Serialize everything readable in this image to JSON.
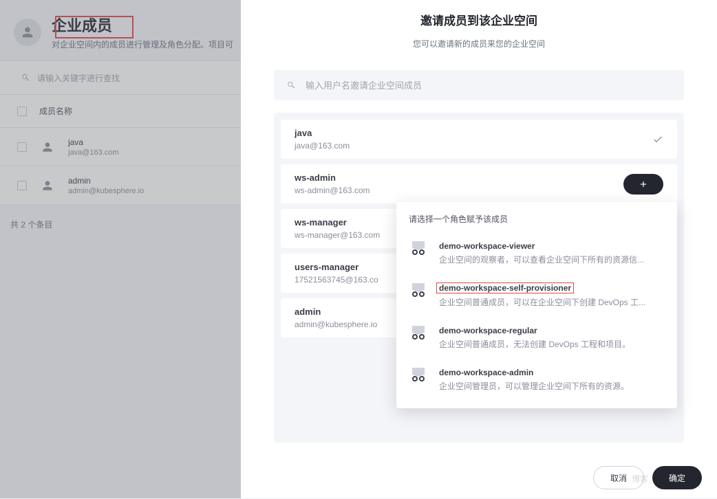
{
  "bg": {
    "title": "企业成员",
    "subtitle": "对企业空间内的成员进行管理及角色分配。项目可",
    "search_placeholder": "请输入关键字进行查找",
    "col_name": "成员名称",
    "rows": [
      {
        "name": "java",
        "email": "java@163.com"
      },
      {
        "name": "admin",
        "email": "admin@kubesphere.io"
      }
    ],
    "footer": "共 2 个条目"
  },
  "modal": {
    "title": "邀请成员到该企业空间",
    "subtitle": "您可以邀请新的成员来您的企业空间",
    "search_placeholder": "输入用户名邀请企业空间成员",
    "users": [
      {
        "name": "java",
        "email": "java@163.com",
        "status": "checked"
      },
      {
        "name": "ws-admin",
        "email": "ws-admin@163.com",
        "status": "add"
      },
      {
        "name": "ws-manager",
        "email": "ws-manager@163.com",
        "status": "none"
      },
      {
        "name": "users-manager",
        "email": "17521563745@163.co",
        "status": "none"
      },
      {
        "name": "admin",
        "email": "admin@kubesphere.io",
        "status": "none"
      }
    ],
    "role_title": "请选择一个角色赋予该成员",
    "roles": [
      {
        "name": "demo-workspace-viewer",
        "desc": "企业空间的观察者，可以查看企业空间下所有的资源信...",
        "highlighted": false
      },
      {
        "name": "demo-workspace-self-provisioner",
        "desc": "企业空间普通成员，可以在企业空间下创建 DevOps 工...",
        "highlighted": true
      },
      {
        "name": "demo-workspace-regular",
        "desc": "企业空间普通成员，无法创建 DevOps 工程和项目。",
        "highlighted": false
      },
      {
        "name": "demo-workspace-admin",
        "desc": "企业空间管理员，可以管理企业空间下所有的资源。",
        "highlighted": false
      }
    ],
    "cancel": "取消",
    "confirm": "确定"
  },
  "watermark": "博客"
}
